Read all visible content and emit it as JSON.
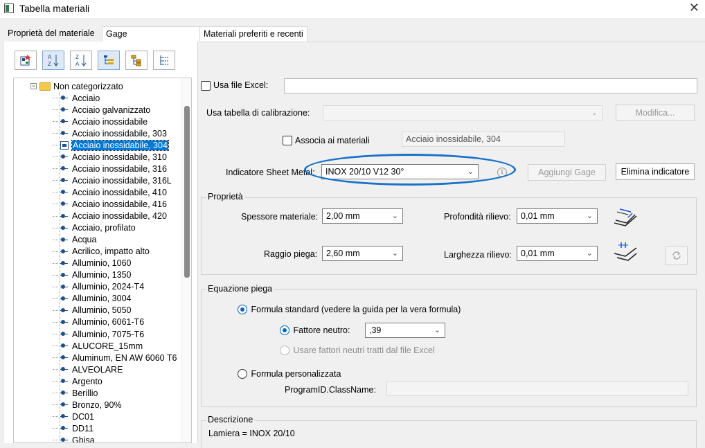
{
  "window": {
    "title": "Tabella materiali",
    "close_glyph": "✕",
    "icon": "table-icon"
  },
  "left_tabs": [
    {
      "label": "Proprietà del materiale"
    },
    {
      "label": "Gage"
    }
  ],
  "right_tab": {
    "label": "Materiali preferiti e recenti"
  },
  "toolbar": {
    "buttons": [
      {
        "icon": "material-properties-icon",
        "active": false
      },
      {
        "icon": "sort-az-icon",
        "active": true
      },
      {
        "icon": "sort-za-icon",
        "active": false
      },
      {
        "icon": "tree-view-icon",
        "active": true
      },
      {
        "icon": "expand-tree-icon",
        "active": false
      },
      {
        "icon": "collapse-tree-icon",
        "active": false
      }
    ]
  },
  "tree": {
    "root": {
      "expander": "−",
      "label": "Non categorizzato"
    },
    "items": [
      "Acciaio",
      "Acciaio galvanizzato",
      "Acciaio inossidabile",
      "Acciaio inossidabile, 303",
      "Acciaio inossidabile, 304",
      "Acciaio inossidabile, 310",
      "Acciaio inossidabile, 316",
      "Acciaio inossidabile, 316L",
      "Acciaio inossidabile, 410",
      "Acciaio inossidabile, 416",
      "Acciaio inossidabile, 420",
      "Acciaio, profilato",
      "Acqua",
      "Acrilico, impatto alto",
      "Alluminio, 1060",
      "Alluminio, 1350",
      "Alluminio, 2024-T4",
      "Alluminio, 3004",
      "Alluminio, 5050",
      "Alluminio, 6061-T6",
      "Alluminio, 7075-T6",
      "ALUCORE_15mm",
      "Aluminum, EN AW 6060 T6",
      "ALVEOLARE",
      "Argento",
      "Berillio",
      "Bronzo, 90%",
      "DC01",
      "DD11",
      "Ghisa"
    ],
    "selected_index": 4
  },
  "excel": {
    "label": "Usa file Excel:",
    "checked": false,
    "value": ""
  },
  "calibration": {
    "label": "Usa tabella di calibrazione:",
    "value": "",
    "modify_button": "Modifica..."
  },
  "associate": {
    "label": "Associa ai materiali",
    "checked": false,
    "material_value": "Acciaio inossidabile, 304"
  },
  "sheet_metal": {
    "label": "Indicatore Sheet Metal:",
    "value": "INOX 20/10 V12 30°",
    "add_gage_button": "Aggiungi Gage",
    "delete_indicator_button": "Elimina indicatore",
    "highlight_color": "#1a73c9"
  },
  "properties": {
    "title": "Proprietà",
    "thickness": {
      "label": "Spessore materiale:",
      "value": "2,00 mm"
    },
    "relief_depth": {
      "label": "Profondità rilievo:",
      "value": "0,01 mm"
    },
    "bend_radius": {
      "label": "Raggio piega:",
      "value": "2,60 mm"
    },
    "relief_width": {
      "label": "Larghezza rilievo:",
      "value": "0,01 mm"
    }
  },
  "bend_equation": {
    "title": "Equazione piega",
    "standard_formula": {
      "label": "Formula standard (vedere la guida per la vera formula)",
      "selected": true
    },
    "neutral_factor": {
      "label": "Fattore neutro:",
      "value": ",39",
      "selected": true
    },
    "excel_factors": {
      "label": "Usare fattori neutri tratti dal file Excel",
      "selected": false,
      "disabled": true
    },
    "custom_formula": {
      "label": "Formula personalizzata",
      "selected": false
    },
    "program_id": {
      "label": "ProgramID.ClassName:",
      "value": ""
    }
  },
  "description": {
    "title": "Descrizione",
    "value": "Lamiera = INOX 20/10"
  }
}
